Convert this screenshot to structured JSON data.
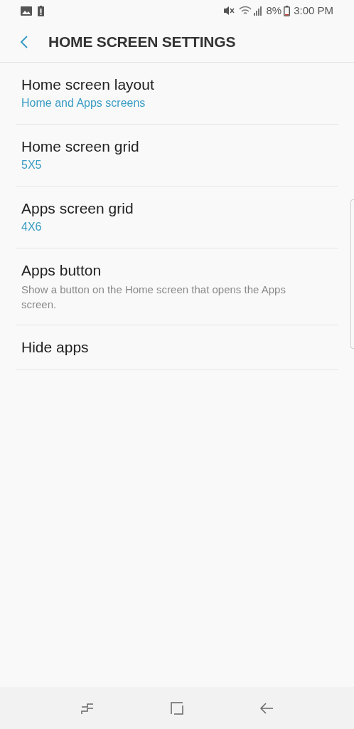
{
  "status_bar": {
    "battery": "8%",
    "time": "3:00 PM"
  },
  "header": {
    "title": "HOME SCREEN SETTINGS"
  },
  "items": [
    {
      "title": "Home screen layout",
      "subtitle": "Home and Apps screens",
      "kind": "value"
    },
    {
      "title": "Home screen grid",
      "subtitle": "5X5",
      "kind": "value"
    },
    {
      "title": "Apps screen grid",
      "subtitle": "4X6",
      "kind": "value"
    },
    {
      "title": "Apps button",
      "subtitle": "Show a button on the Home screen that opens the Apps screen.",
      "kind": "description"
    },
    {
      "title": "Hide apps"
    }
  ]
}
